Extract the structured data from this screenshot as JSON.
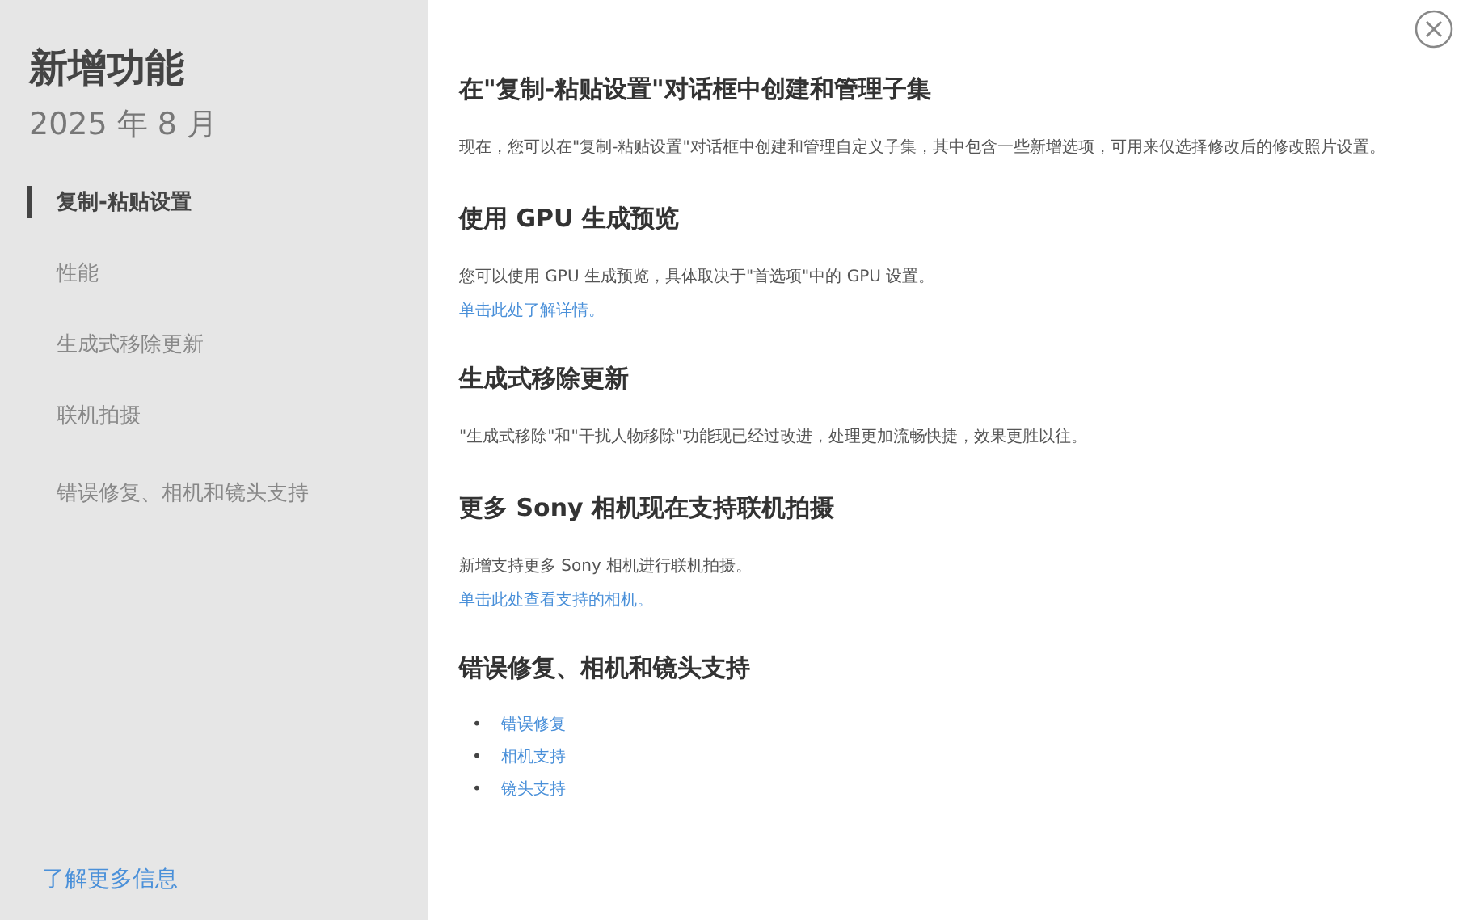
{
  "sidebar": {
    "title": "新增功能",
    "date": "2025 年 8 月",
    "items": [
      {
        "label": "复制-粘贴设置",
        "selected": true
      },
      {
        "label": "性能",
        "selected": false
      },
      {
        "label": "生成式移除更新",
        "selected": false
      },
      {
        "label": "联机拍摄",
        "selected": false
      },
      {
        "label": "错误修复、相机和镜头支持",
        "selected": false
      }
    ],
    "footer_link": "了解更多信息"
  },
  "sections": [
    {
      "heading": "在\"复制-粘贴设置\"对话框中创建和管理子集",
      "text": "现在，您可以在\"复制-粘贴设置\"对话框中创建和管理自定义子集，其中包含一些新增选项，可用来仅选择修改后的修改照片设置。"
    },
    {
      "heading": "使用 GPU 生成预览",
      "text": "您可以使用 GPU 生成预览，具体取决于\"首选项\"中的 GPU 设置。",
      "link": "单击此处了解详情。"
    },
    {
      "heading": "生成式移除更新",
      "text": "\"生成式移除\"和\"干扰人物移除\"功能现已经过改进，处理更加流畅快捷，效果更胜以往。"
    },
    {
      "heading": "更多 Sony 相机现在支持联机拍摄",
      "text": "新增支持更多 Sony 相机进行联机拍摄。",
      "link": "单击此处查看支持的相机。"
    },
    {
      "heading": "错误修复、相机和镜头支持",
      "list": [
        {
          "bullet": "•",
          "label": "错误修复"
        },
        {
          "bullet": "•",
          "label": "相机支持"
        },
        {
          "bullet": "•",
          "label": "镜头支持"
        }
      ]
    }
  ]
}
